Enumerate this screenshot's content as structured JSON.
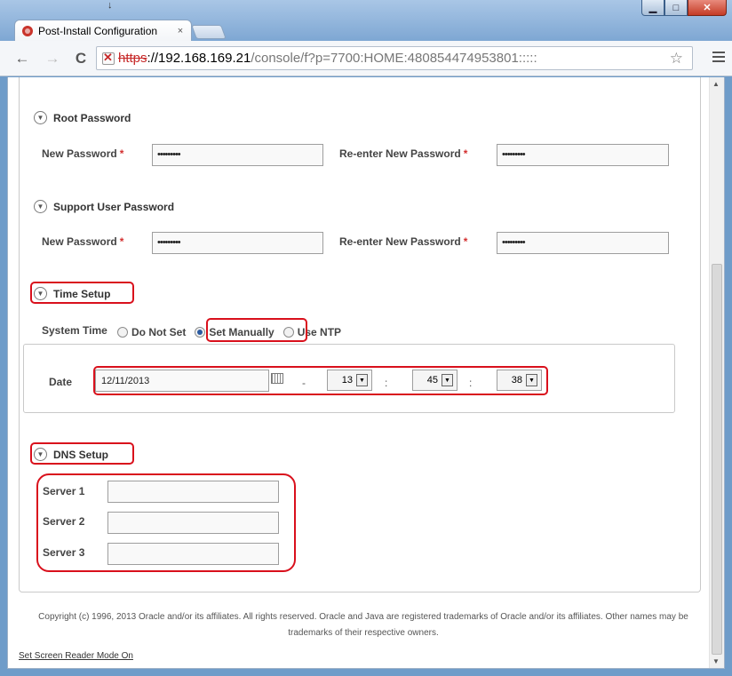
{
  "window": {
    "minimize": "▁",
    "maximize": "□",
    "close": "✕",
    "download_arrow": "↓"
  },
  "tab": {
    "title": "Post-Install Configuration",
    "close": "×"
  },
  "toolbar": {
    "back": "←",
    "forward": "→",
    "reload": "C",
    "url_scheme": "https",
    "url_host": "://192.168.169.21",
    "url_path": "/console/f?p=7700:HOME:480854474953801:::::",
    "star": "☆"
  },
  "root_password": {
    "title": "Root Password",
    "new_label": "New Password",
    "reenter_label": "Re-enter New Password",
    "new_value": "•••••••••",
    "reenter_value": "•••••••••",
    "required": "*"
  },
  "support_password": {
    "title": "Support User Password",
    "new_label": "New Password",
    "reenter_label": "Re-enter New Password",
    "new_value": "•••••••••",
    "reenter_value": "•••••••••",
    "required": "*"
  },
  "time_setup": {
    "title": "Time Setup",
    "system_time_label": "System Time",
    "options": [
      "Do Not Set",
      "Set Manually",
      "Use NTP"
    ],
    "selected": "Set Manually",
    "date_label": "Date",
    "date_value": "12/11/2013",
    "dash": "-",
    "colon": ":",
    "hour": "13",
    "minute": "45",
    "second": "38"
  },
  "dns_setup": {
    "title": "DNS Setup",
    "server1_label": "Server 1",
    "server2_label": "Server 2",
    "server3_label": "Server 3",
    "server1_value": "",
    "server2_value": "",
    "server3_value": ""
  },
  "footer": {
    "copyright": "Copyright (c) 1996, 2013 Oracle and/or its affiliates. All rights reserved. Oracle and Java are registered trademarks of Oracle and/or its affiliates. Other names may be trademarks of their respective owners.",
    "screen_reader_link": "Set Screen Reader Mode On"
  },
  "colors": {
    "highlight": "#d9101c",
    "required": "#d32f2f",
    "frame": "#7ea7d3"
  }
}
